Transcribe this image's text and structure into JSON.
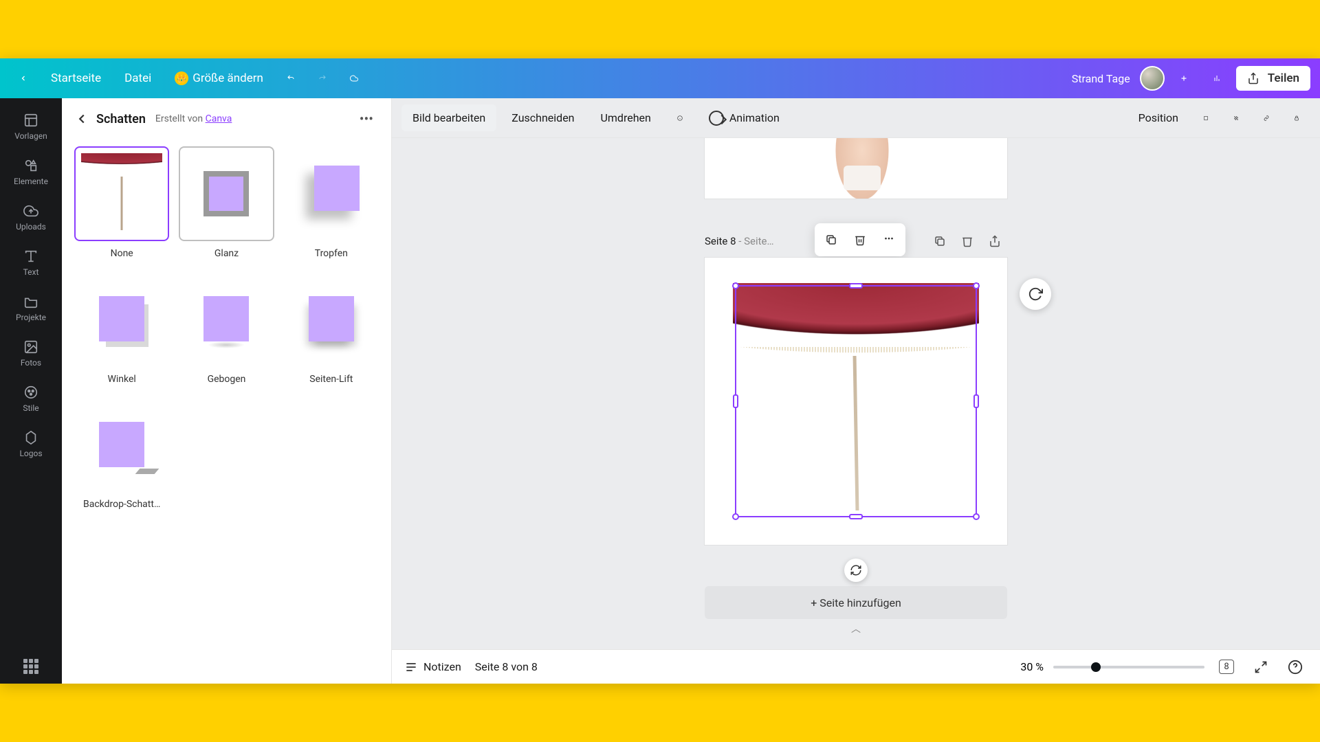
{
  "topbar": {
    "home": "Startseite",
    "file": "Datei",
    "resize": "Größe ändern",
    "project_name": "Strand Tage",
    "share": "Teilen"
  },
  "rail": {
    "templates": "Vorlagen",
    "elements": "Elemente",
    "uploads": "Uploads",
    "text": "Text",
    "projects": "Projekte",
    "photos": "Fotos",
    "styles": "Stile",
    "logos": "Logos"
  },
  "panel": {
    "title": "Schatten",
    "created_by": "Erstellt von ",
    "creator": "Canva",
    "shadows": [
      {
        "key": "none",
        "label": "None",
        "selected": true
      },
      {
        "key": "glanz",
        "label": "Glanz",
        "hovered": true
      },
      {
        "key": "tropfen",
        "label": "Tropfen"
      },
      {
        "key": "winkel",
        "label": "Winkel"
      },
      {
        "key": "gebogen",
        "label": "Gebogen"
      },
      {
        "key": "seitenlift",
        "label": "Seiten-Lift"
      },
      {
        "key": "backdrop",
        "label": "Backdrop-Schatt…"
      }
    ]
  },
  "toolbar": {
    "edit_image": "Bild bearbeiten",
    "crop": "Zuschneiden",
    "flip": "Umdrehen",
    "animation": "Animation",
    "position": "Position"
  },
  "canvas": {
    "page_label": "Seite 8",
    "page_label_sub": " - Seite…",
    "add_page": "+ Seite hinzufügen"
  },
  "footer": {
    "notes": "Notizen",
    "page_of": "Seite 8 von 8",
    "zoom": "30 %",
    "page_count": "8"
  },
  "colors": {
    "accent": "#8b3dff",
    "teal": "#00c4cc"
  }
}
